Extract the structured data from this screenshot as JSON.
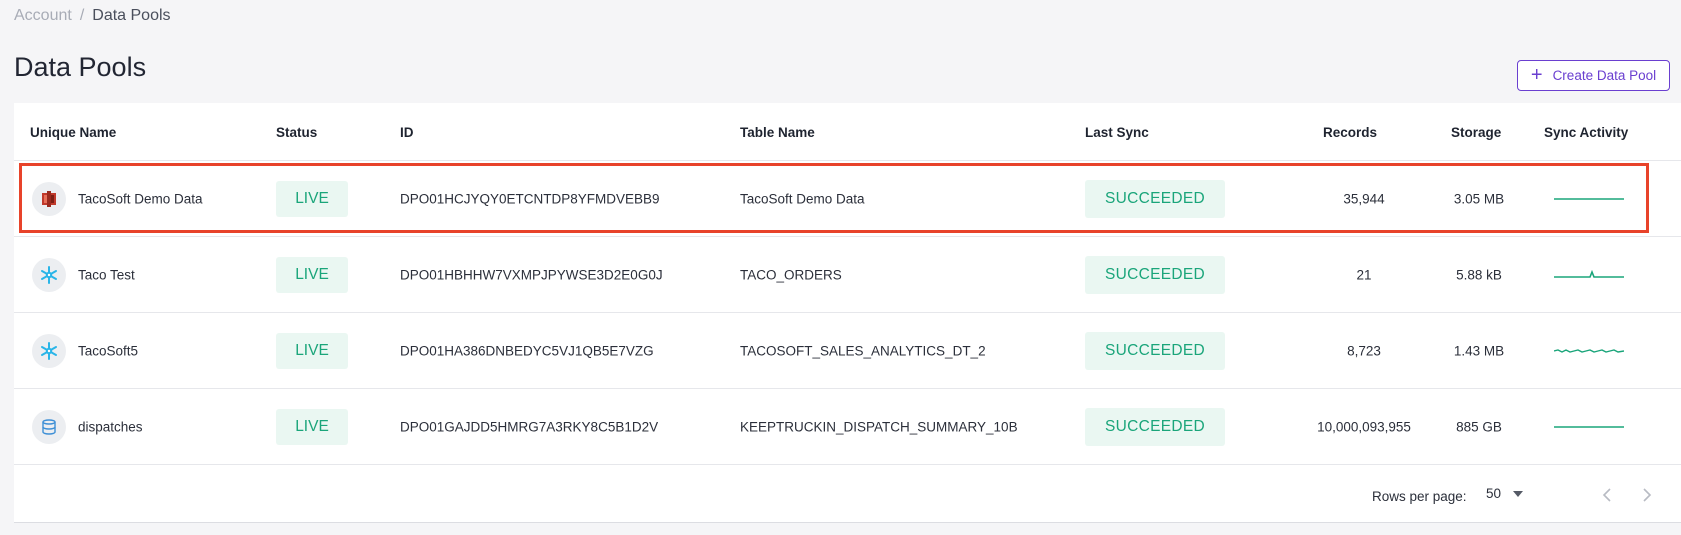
{
  "breadcrumb": {
    "parent": "Account",
    "separator": "/",
    "current": "Data Pools"
  },
  "page_title": "Data Pools",
  "create_button": {
    "label": "Create Data Pool",
    "icon": "plus-icon"
  },
  "table": {
    "columns": {
      "unique_name": "Unique Name",
      "status": "Status",
      "id": "ID",
      "table_name": "Table Name",
      "last_sync": "Last Sync",
      "records": "Records",
      "storage": "Storage",
      "sync_activity": "Sync Activity"
    },
    "rows": [
      {
        "icon": "redshift-icon",
        "name": "TacoSoft Demo Data",
        "status": "LIVE",
        "id": "DPO01HCJYQY0ETCNTDP8YFMDVEBB9",
        "table_name": "TacoSoft Demo Data",
        "last_sync": "SUCCEEDED",
        "records": "35,944",
        "storage": "3.05 MB"
      },
      {
        "icon": "snowflake-icon",
        "name": "Taco Test",
        "status": "LIVE",
        "id": "DPO01HBHHW7VXMPJPYWSE3D2E0G0J",
        "table_name": "TACO_ORDERS",
        "last_sync": "SUCCEEDED",
        "records": "21",
        "storage": "5.88 kB"
      },
      {
        "icon": "snowflake-icon",
        "name": "TacoSoft5",
        "status": "LIVE",
        "id": "DPO01HA386DNBEDYC5VJ1QB5E7VZG",
        "table_name": "TACOSOFT_SALES_ANALYTICS_DT_2",
        "last_sync": "SUCCEEDED",
        "records": "8,723",
        "storage": "1.43 MB"
      },
      {
        "icon": "database-icon",
        "name": "dispatches",
        "status": "LIVE",
        "id": "DPO01GAJDD5HMRG7A3RKY8C5B1D2V",
        "table_name": "KEEPTRUCKIN_DISPATCH_SUMMARY_10B",
        "last_sync": "SUCCEEDED",
        "records": "10,000,093,955",
        "storage": "885 GB"
      }
    ]
  },
  "pagination": {
    "rows_per_page_label": "Rows per page:",
    "rows_per_page_value": "50"
  },
  "colors": {
    "accent": "#6a3fd0",
    "success": "#1aa57a",
    "success_bg": "#eaf7f2",
    "highlight": "#e8432a"
  }
}
